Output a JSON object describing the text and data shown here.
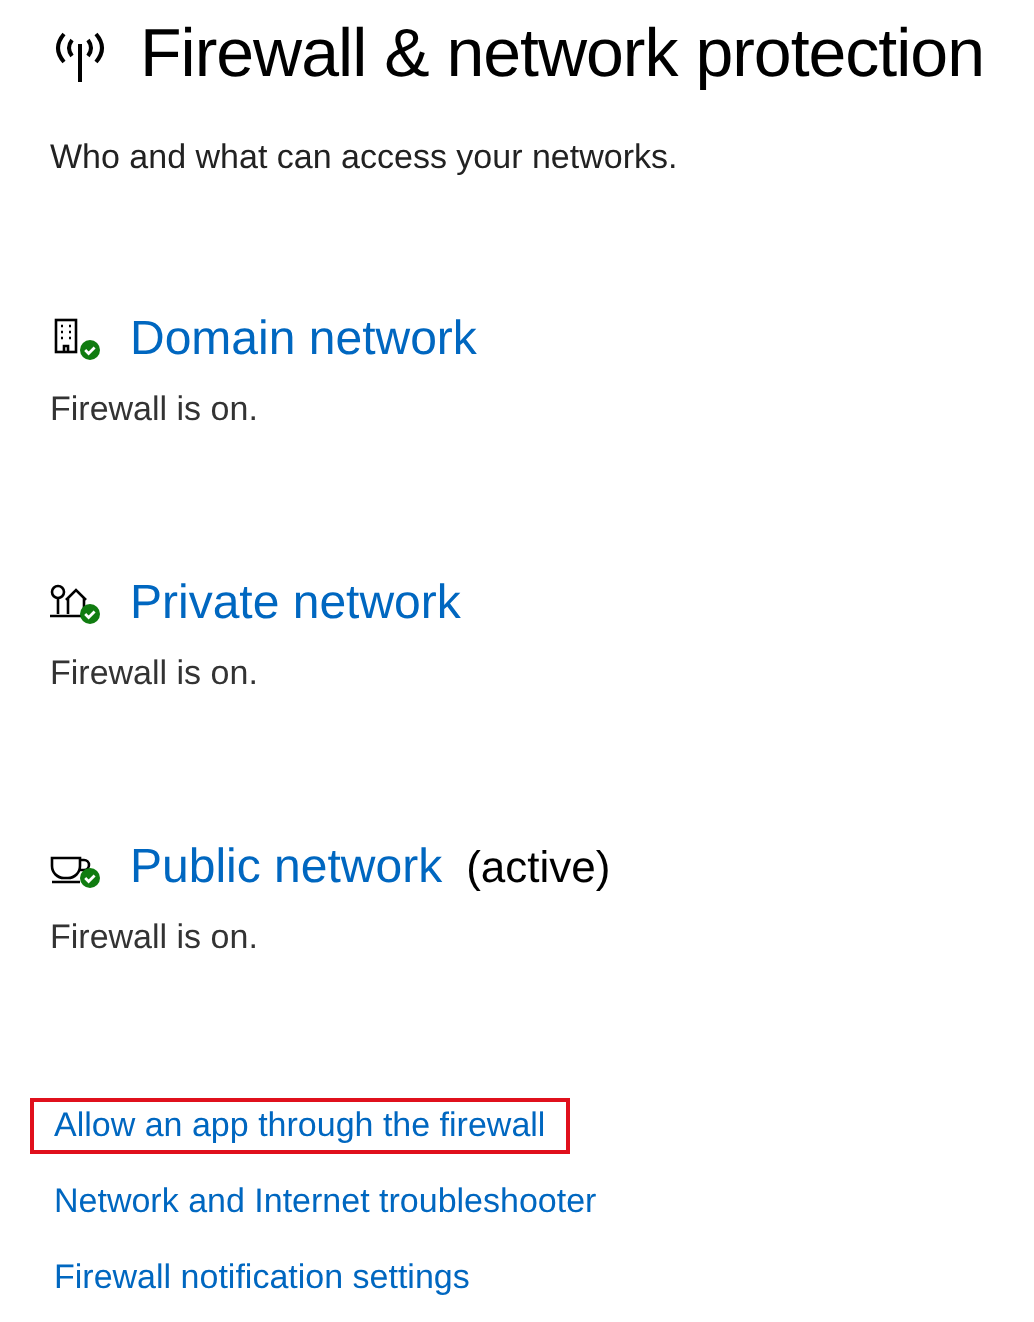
{
  "title": "Firewall & network protection",
  "subtitle": "Who and what can access your networks.",
  "networks": [
    {
      "kind": "domain",
      "name": "Domain network",
      "status": "Firewall is on.",
      "protected": true
    },
    {
      "kind": "private",
      "name": "Private network",
      "status": "Firewall is on.",
      "protected": true
    },
    {
      "kind": "public",
      "name": "Public network",
      "note": "(active)",
      "status": "Firewall is on.",
      "protected": true
    }
  ],
  "links": [
    {
      "label": "Allow an app through the firewall",
      "highlighted": true
    },
    {
      "label": "Network and Internet troubleshooter",
      "highlighted": false
    },
    {
      "label": "Firewall notification settings",
      "highlighted": false
    }
  ]
}
